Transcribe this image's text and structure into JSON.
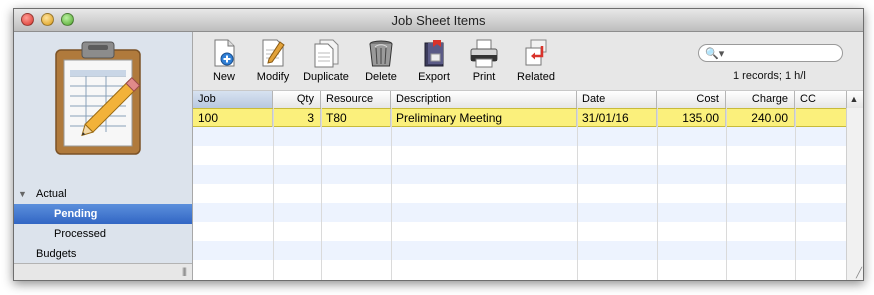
{
  "window": {
    "title": "Job Sheet Items"
  },
  "sidebar": {
    "items": [
      {
        "label": "Actual",
        "expanded": true
      },
      {
        "label": "Pending",
        "selected": true
      },
      {
        "label": "Processed"
      },
      {
        "label": "Budgets"
      }
    ]
  },
  "toolbar": {
    "buttons": [
      {
        "label": "New",
        "icon": "new-document-icon"
      },
      {
        "label": "Modify",
        "icon": "pencil-document-icon"
      },
      {
        "label": "Duplicate",
        "icon": "duplicate-document-icon"
      },
      {
        "label": "Delete",
        "icon": "trash-bin-icon"
      },
      {
        "label": "Export",
        "icon": "export-book-icon"
      },
      {
        "label": "Print",
        "icon": "printer-icon"
      },
      {
        "label": "Related",
        "icon": "related-arrow-icon"
      }
    ],
    "search": {
      "value": "",
      "placeholder": ""
    },
    "record_count": "1 records; 1 h/l"
  },
  "table": {
    "columns": [
      "Job",
      "Qty",
      "Resource",
      "Description",
      "Date",
      "Cost",
      "Charge",
      "CC"
    ],
    "rows": [
      {
        "job": "100",
        "qty": "3",
        "resource": "T80",
        "description": "Preliminary Meeting",
        "date": "31/01/16",
        "cost": "135.00",
        "charge": "240.00",
        "cc": ""
      }
    ]
  },
  "colors": {
    "selected_row": "#fbf07c",
    "sidebar_selection": "#3d6fcc",
    "alt_row": "#edf3fe"
  }
}
